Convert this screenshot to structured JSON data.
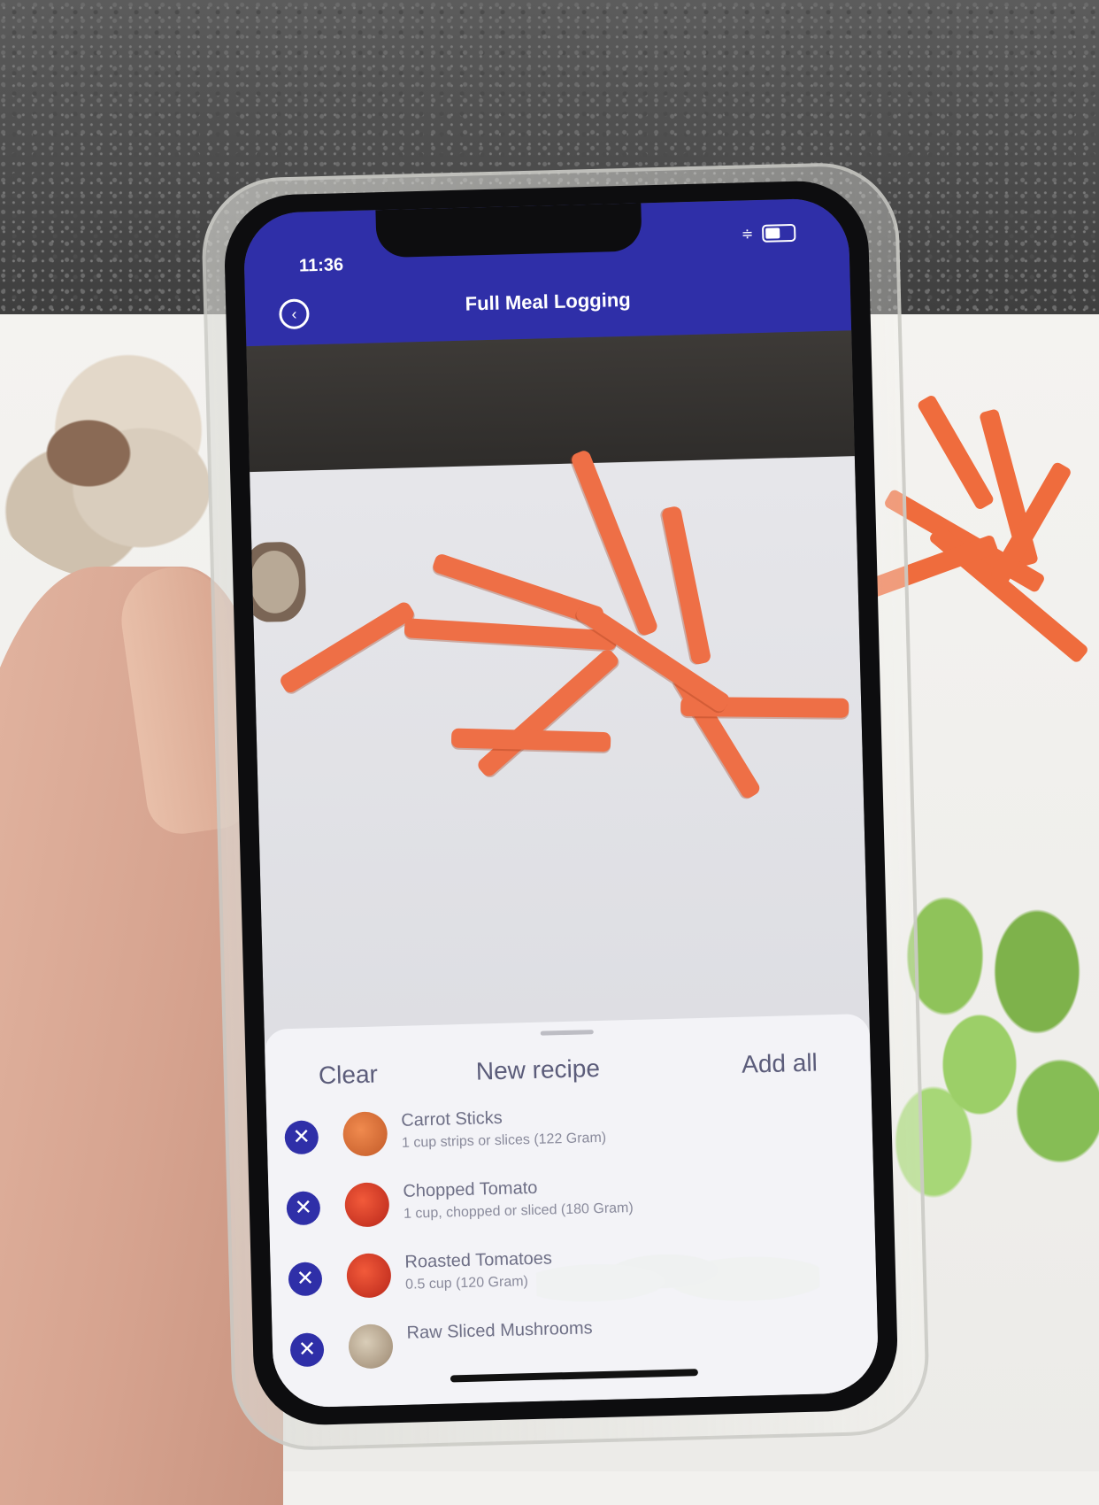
{
  "status_bar": {
    "time": "11:36"
  },
  "header": {
    "title": "Full Meal Logging"
  },
  "sheet": {
    "clear_label": "Clear",
    "new_recipe_label": "New recipe",
    "add_all_label": "Add all",
    "items": [
      {
        "name": "Carrot Sticks",
        "portion": "1 cup strips or slices (122 Gram)",
        "thumb": "carrot"
      },
      {
        "name": "Chopped Tomato",
        "portion": "1 cup, chopped or sliced (180 Gram)",
        "thumb": "tomato"
      },
      {
        "name": "Roasted Tomatoes",
        "portion": "0.5 cup (120 Gram)",
        "thumb": "tomato"
      },
      {
        "name": "Raw Sliced Mushrooms",
        "portion": "",
        "thumb": "mushroom"
      }
    ]
  },
  "colors": {
    "header_bg": "#2f2fa8",
    "remove_button": "#2f2fa8"
  }
}
